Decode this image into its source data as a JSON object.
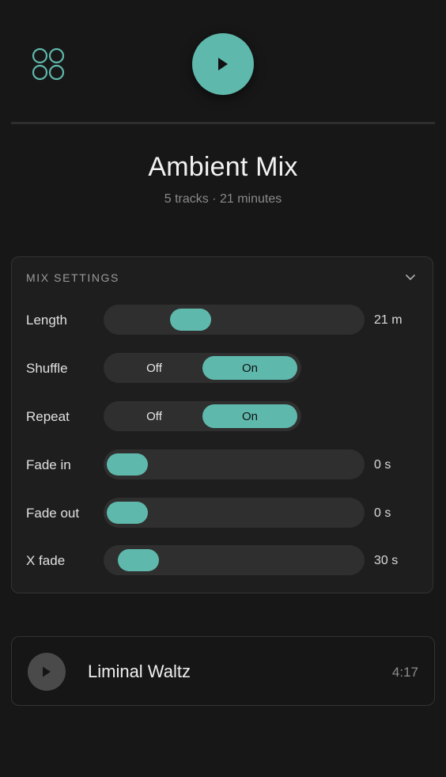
{
  "header": {
    "menu_icon": "grid-icon",
    "play_icon": "play-icon",
    "accent_color": "#5fb8ac"
  },
  "mix": {
    "title": "Ambient Mix",
    "subtitle": "5 tracks · 21 minutes"
  },
  "settings": {
    "title": "MIX SETTINGS",
    "collapse_icon": "chevron-down-icon",
    "length": {
      "label": "Length",
      "value": "21 m",
      "level": 0.28
    },
    "shuffle": {
      "label": "Shuffle",
      "off_label": "Off",
      "on_label": "On",
      "selected": "On"
    },
    "repeat": {
      "label": "Repeat",
      "off_label": "Off",
      "on_label": "On",
      "selected": "On"
    },
    "fade_in": {
      "label": "Fade in",
      "value": "0 s",
      "level": 0.0
    },
    "fade_out": {
      "label": "Fade out",
      "value": "0 s",
      "level": 0.0
    },
    "x_fade": {
      "label": "X fade",
      "value": "30 s",
      "level": 0.05
    }
  },
  "track": {
    "title": "Liminal Waltz",
    "duration": "4:17",
    "play_icon": "play-icon"
  }
}
